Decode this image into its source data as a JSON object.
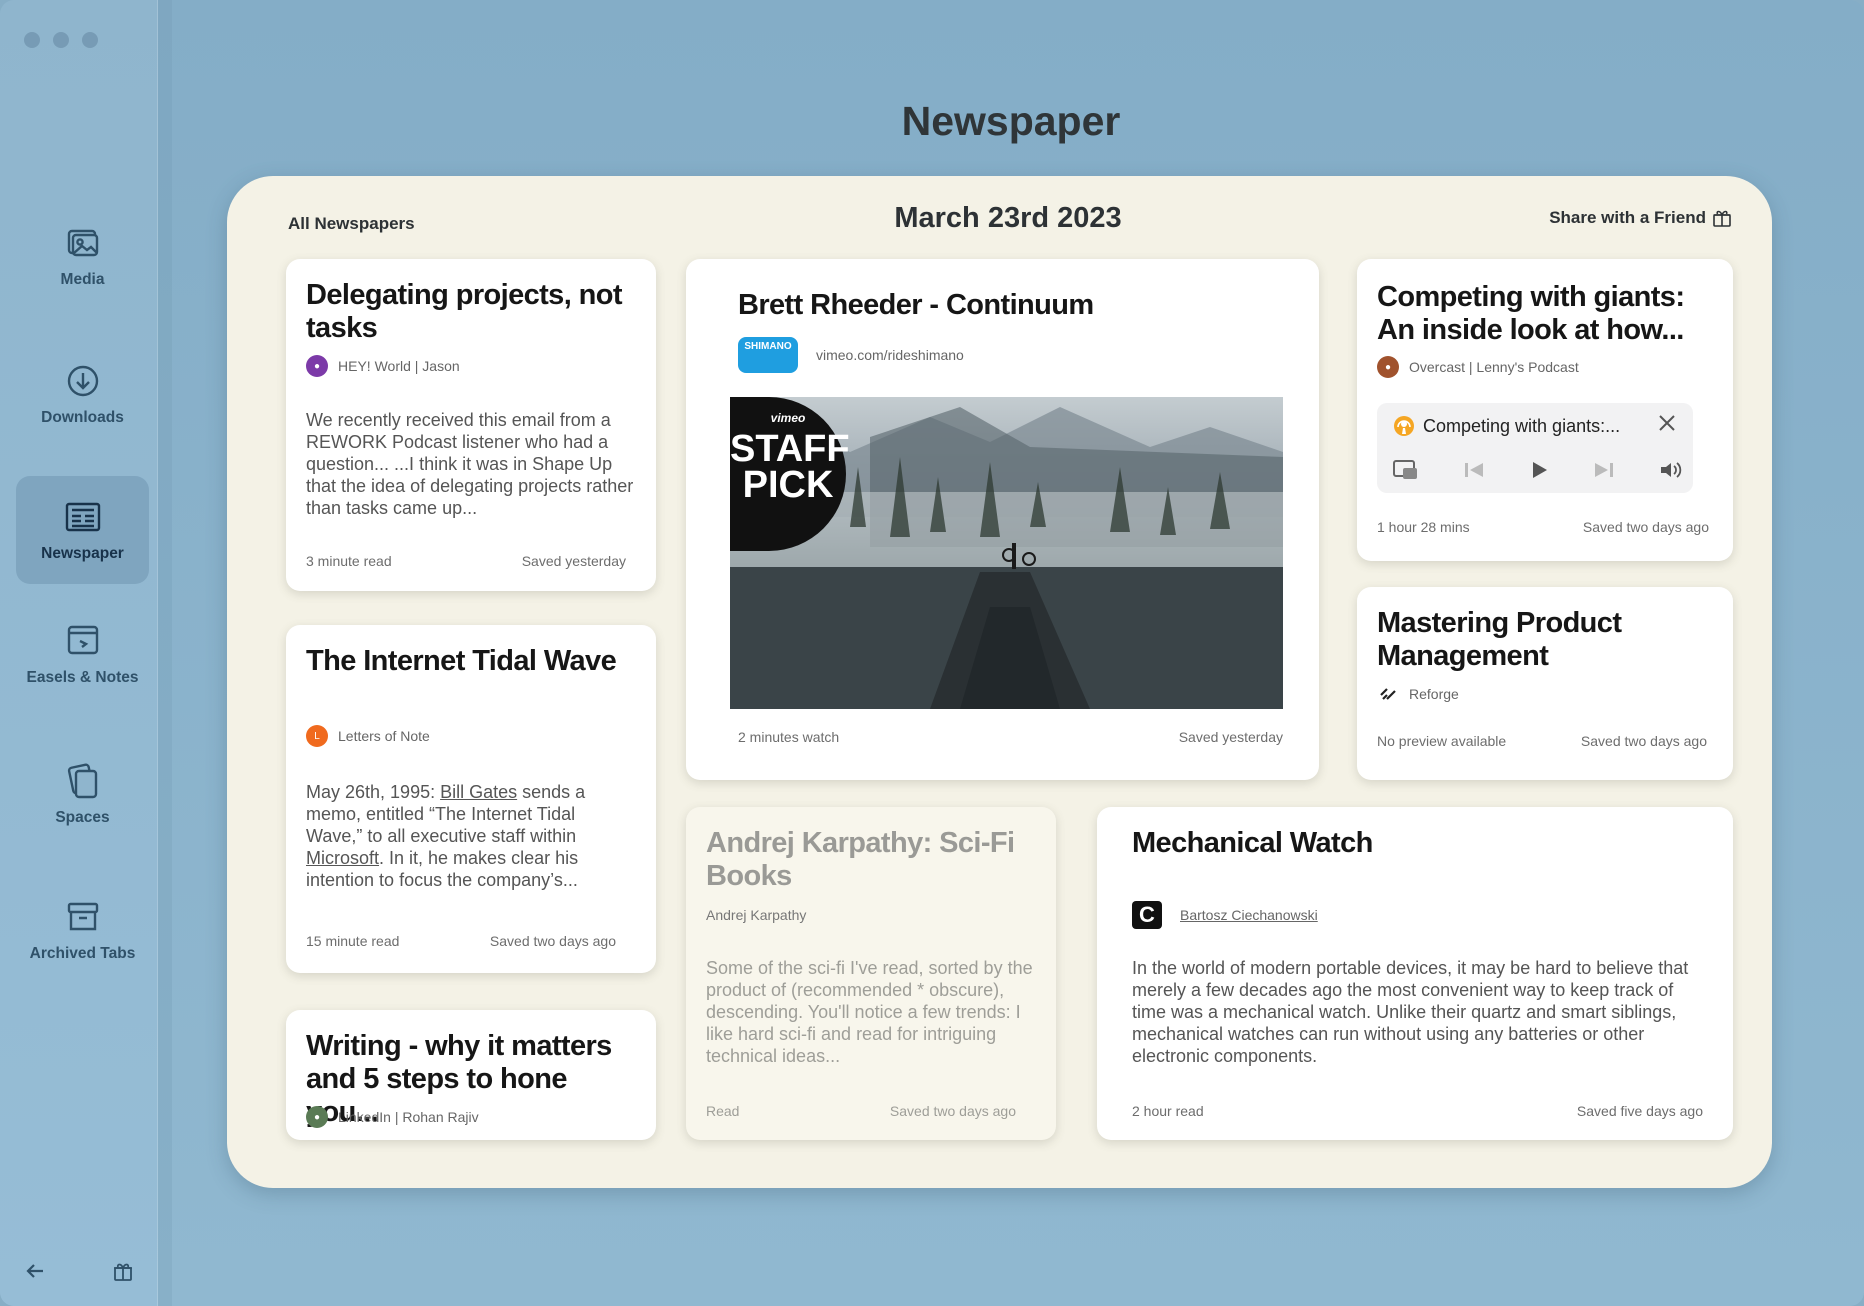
{
  "app": {
    "page_title": "Newspaper"
  },
  "sidebar": {
    "items": [
      {
        "label": "Media",
        "icon": "image-icon"
      },
      {
        "label": "Downloads",
        "icon": "download-icon"
      },
      {
        "label": "Newspaper",
        "icon": "newspaper-icon",
        "active": true
      },
      {
        "label": "Easels & Notes",
        "icon": "easel-icon"
      },
      {
        "label": "Spaces",
        "icon": "spaces-icon"
      },
      {
        "label": "Archived Tabs",
        "icon": "archive-icon"
      }
    ],
    "bottom": {
      "back_icon": "arrow-left-icon",
      "gift_icon": "gift-icon"
    }
  },
  "board": {
    "all_label": "All Newspapers",
    "date": "March 23rd 2023",
    "share_label": "Share with a Friend"
  },
  "cards": {
    "delegating": {
      "title": "Delegating projects, not tasks",
      "source": "HEY! World | Jason",
      "excerpt": "We recently received this email from a REWORK Podcast listener who had a question...  ...I think it was in Shape Up that the idea of delegating projects rather than tasks came up...",
      "read": "3 minute read",
      "saved": "Saved yesterday"
    },
    "tidal": {
      "title": "The Internet Tidal Wave",
      "source": "Letters of Note",
      "excerpt_pre": "May 26th, 1995: ",
      "excerpt_link1": "Bill Gates",
      "excerpt_mid": " sends a memo, entitled “The Internet Tidal Wave,” to all executive staff within ",
      "excerpt_link2": "Microsoft",
      "excerpt_post": ". In it, he makes clear his intention to focus the company’s...",
      "read": "15 minute read",
      "saved": "Saved two days ago"
    },
    "writing": {
      "title": "Writing - why it matters and 5 steps to hone you...",
      "source": "LinkedIn | Rohan Rajiv"
    },
    "brett": {
      "title": "Brett Rheeder - Continuum",
      "source": "vimeo.com/rideshimano",
      "logo_text": "SHIMANO",
      "badge_top": "vimeo",
      "badge_line1": "STAFF",
      "badge_line2": "PICK",
      "read": "2 minutes watch",
      "saved": "Saved yesterday"
    },
    "competing": {
      "title": "Competing with giants: An inside look at how...",
      "source": "Overcast | Lenny's Podcast",
      "player_title": "Competing with giants:...",
      "read": "1 hour 28 mins",
      "saved": "Saved two days ago"
    },
    "mastering": {
      "title": "Mastering Product Management",
      "source": "Reforge",
      "read": "No preview available",
      "saved": "Saved two days ago"
    },
    "karpathy": {
      "title": "Andrej Karpathy: Sci-Fi Books",
      "source": "Andrej Karpathy",
      "excerpt": "Some of the sci-fi I've read, sorted by the product of (recommended * obscure), descending. You'll notice a few trends: I like hard sci-fi and read for intriguing technical ideas...",
      "read": "Read",
      "saved": "Saved two days ago"
    },
    "watch": {
      "title": "Mechanical Watch",
      "source": "Bartosz Ciechanowski",
      "excerpt": "In the world of modern portable devices, it may be hard to believe that merely a few decades ago the most convenient way to keep track of time was a mechanical watch. Unlike their quartz and smart siblings, mechanical watches can run without using any batteries or other electronic components.",
      "read": "2 hour read",
      "saved": "Saved five days ago"
    }
  }
}
